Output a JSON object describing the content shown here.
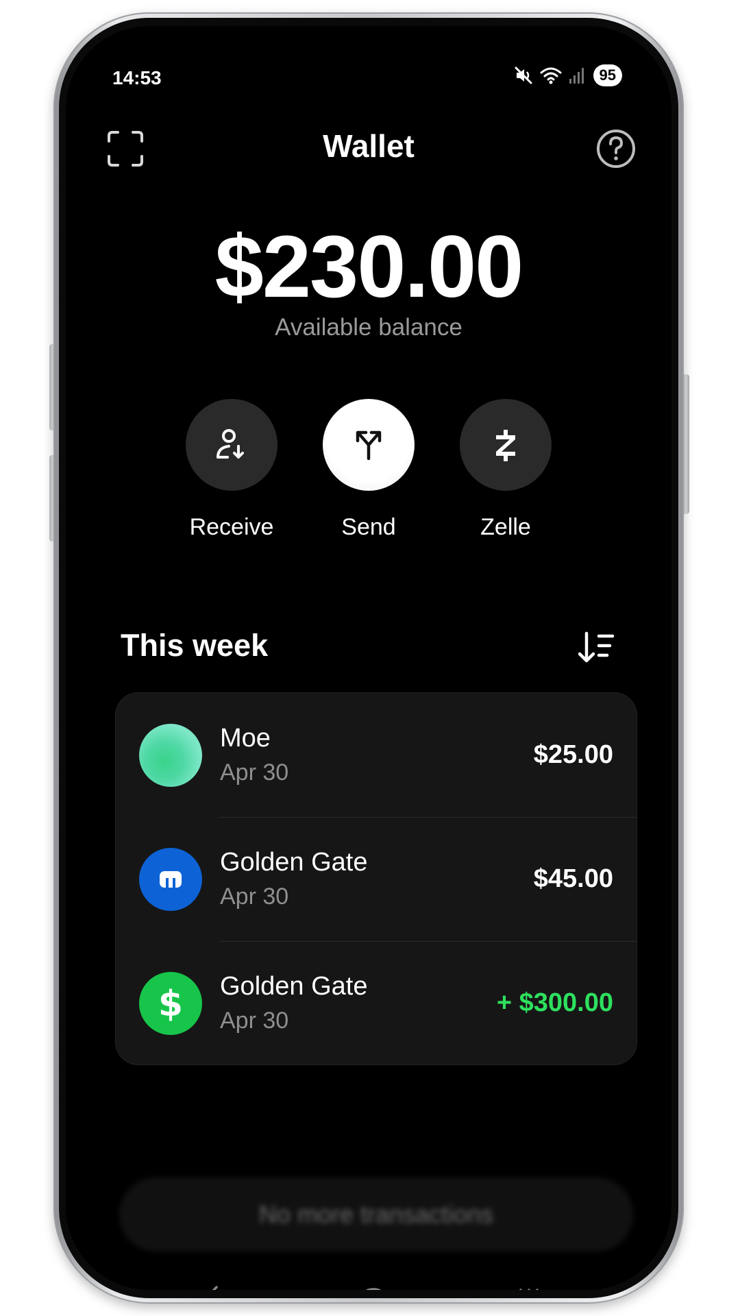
{
  "status_bar": {
    "time": "14:53",
    "battery": "95",
    "icons": [
      "mute-icon",
      "wifi-icon",
      "signal-icon"
    ]
  },
  "header": {
    "title": "Wallet",
    "left_icon": "scan-icon",
    "right_icon": "help-icon"
  },
  "balance": {
    "amount": "$230.00",
    "label": "Available balance"
  },
  "actions": [
    {
      "label": "Receive",
      "icon": "receive-icon"
    },
    {
      "label": "Send",
      "icon": "send-icon"
    },
    {
      "label": "Zelle",
      "icon": "zelle-icon"
    }
  ],
  "section": {
    "title": "This week",
    "sort_icon": "sort-icon"
  },
  "transactions": [
    {
      "name": "Moe",
      "date": "Apr 30",
      "amount": "$25.00",
      "avatar": "gradient-avatar"
    },
    {
      "name": "Golden Gate",
      "date": "Apr 30",
      "amount": "$45.00",
      "avatar": "bank-icon"
    },
    {
      "name": "Golden Gate",
      "date": "Apr 30",
      "amount": "+ $300.00",
      "avatar": "dollar-icon"
    }
  ],
  "footer": {
    "no_more": "No more transactions"
  },
  "colors": {
    "background": "#000000",
    "card": "#161616",
    "credit": "#2ee05e",
    "bank_blue": "#0d63d6",
    "cash_green": "#17c54a",
    "muted_text": "#9a9a9a"
  }
}
